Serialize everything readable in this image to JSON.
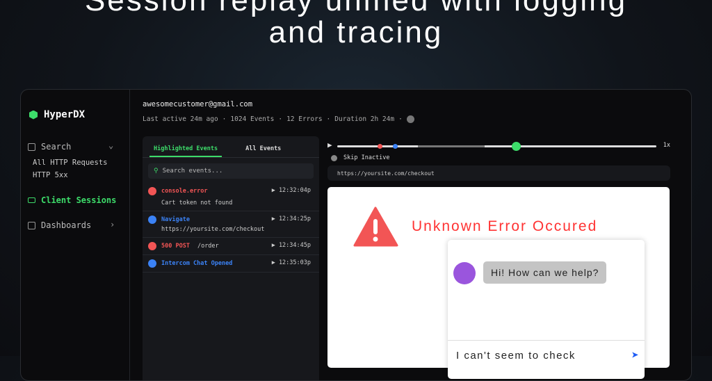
{
  "hero": {
    "line1": "Session replay unified with logging",
    "line2": "and tracing"
  },
  "sidebar": {
    "brand": "HyperDX",
    "search": "Search",
    "saved": [
      "All HTTP Requests",
      "HTTP 5xx"
    ],
    "client_sessions": "Client Sessions",
    "dashboards": "Dashboards"
  },
  "session": {
    "email": "awesomecustomer@gmail.com",
    "last_active": "Last active 24m ago",
    "events": "1024 Events",
    "errors": "12 Errors",
    "duration": "Duration 2h 24m",
    "sep": "·"
  },
  "events_panel": {
    "tabs": [
      "Highlighted Events",
      "All Events"
    ],
    "search_placeholder": "Search events...",
    "items": [
      {
        "name": "console.error",
        "color": "#f25555",
        "time": "12:32:04p",
        "desc": "Cart token not found"
      },
      {
        "name": "Navigate",
        "color": "#3b82f6",
        "time": "12:34:25p",
        "desc": "https://yoursite.com/checkout"
      },
      {
        "name": "500 POST",
        "color": "#f25555",
        "time": "12:34:45p",
        "extra": "/order"
      },
      {
        "name": "Intercom Chat Opened",
        "color": "#3b82f6",
        "time": "12:35:03p"
      }
    ]
  },
  "player": {
    "speed": "1x",
    "skip_inactive": "Skip Inactive",
    "url": "https://yoursite.com/checkout",
    "progress_percent": 56
  },
  "page": {
    "error_title": "Unknown Error Occured",
    "chat_greeting": "Hi! How can we help?",
    "chat_input": "I can't seem to check"
  }
}
